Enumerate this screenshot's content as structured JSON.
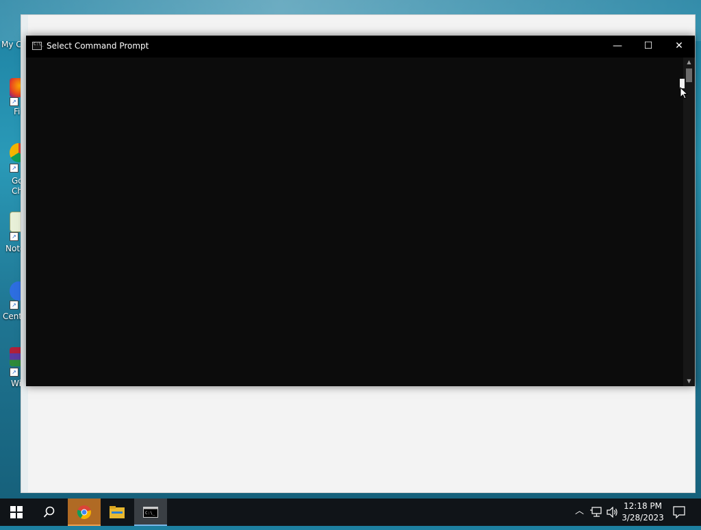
{
  "desktop": {
    "icons": [
      {
        "label": "My C"
      },
      {
        "label": "Fi"
      },
      {
        "label": "Go\nCh"
      },
      {
        "label": "Note"
      },
      {
        "label": "Cent"
      },
      {
        "label": "Wi"
      }
    ]
  },
  "cmd_window": {
    "title": "Select Command Prompt",
    "minimize_glyph": "—",
    "maximize_glyph": "☐",
    "close_glyph": "✕",
    "icon_text": "C:\\_"
  },
  "taskbar": {
    "clock_time": "12:18 PM",
    "clock_date": "3/28/2023",
    "apps": [
      "start-icon",
      "search-icon",
      "chrome-icon",
      "file-explorer-icon",
      "command-prompt-icon"
    ]
  },
  "colors": {
    "console_bg": "#0c0c0c",
    "titlebar_bg": "#000000",
    "taskbar_bg": "#101418",
    "chrome_highlight": "#b06a24"
  }
}
